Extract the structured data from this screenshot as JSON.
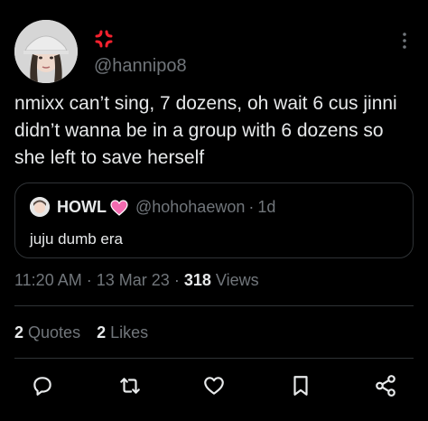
{
  "tweet": {
    "handle": "@hannipo8",
    "text": "nmixx can’t sing, 7 dozens, oh wait 6 cus jinni didn’t wanna be in a group with 6 dozens so she left to save herself",
    "display_name_icon": "anger-symbol-icon"
  },
  "quote": {
    "name": "HOWL",
    "handle": "@hohohaewon",
    "separator": "·",
    "age": "1d",
    "text": "juju dumb era",
    "name_icon": "pink-heart-icon"
  },
  "meta": {
    "time": "11:20 AM",
    "sep1": "·",
    "date": "13 Mar 23",
    "sep2": "·",
    "views_count": "318",
    "views_label": "Views"
  },
  "stats": {
    "quotes_count": "2",
    "quotes_label": "Quotes",
    "likes_count": "2",
    "likes_label": "Likes"
  },
  "actions": [
    "reply-icon",
    "retweet-icon",
    "like-icon",
    "bookmark-icon",
    "share-icon"
  ],
  "colors": {
    "background": "#000000",
    "text": "#e7e9ea",
    "secondary": "#71767b",
    "border": "#2f3336",
    "anger": "#f4212e",
    "heart": "#f26bb0"
  }
}
